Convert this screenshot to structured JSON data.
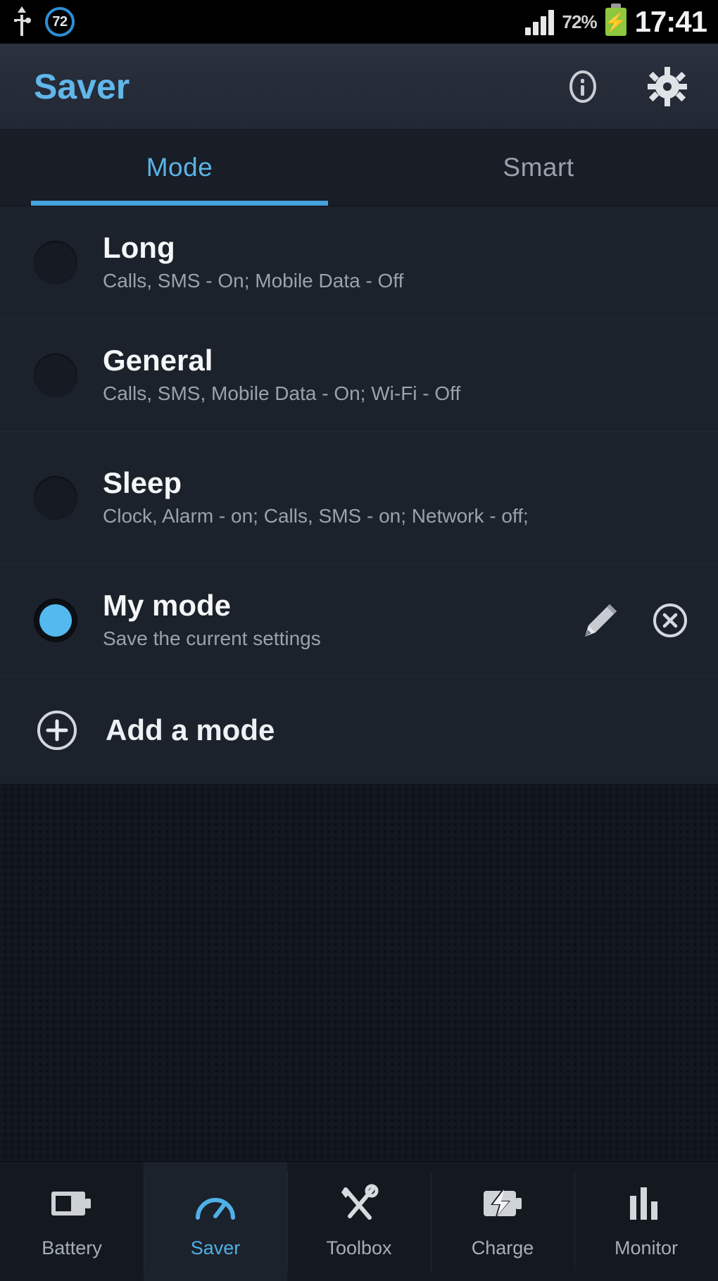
{
  "status_bar": {
    "usb_icon": "usb-icon",
    "sync_badge_value": "72",
    "signal_icon": "signal-bars-icon",
    "battery_percent": "72%",
    "battery_icon": "battery-charging-icon",
    "time": "17:41"
  },
  "action_bar": {
    "title": "Saver",
    "info_icon": "info-circle-icon",
    "settings_icon": "gear-icon"
  },
  "tabs": [
    {
      "label": "Mode",
      "active": true
    },
    {
      "label": "Smart",
      "active": false
    }
  ],
  "modes": [
    {
      "title": "Long",
      "subtitle": "Calls, SMS - On; Mobile Data - Off",
      "selected": false,
      "editable": false
    },
    {
      "title": "General",
      "subtitle": "Calls, SMS, Mobile Data - On; Wi-Fi - Off",
      "selected": false,
      "editable": false
    },
    {
      "title": "Sleep",
      "subtitle": "Clock, Alarm - on; Calls, SMS - on; Network - off;",
      "selected": false,
      "editable": false
    },
    {
      "title": "My mode",
      "subtitle": "Save the current settings",
      "selected": true,
      "editable": true,
      "edit_icon": "pencil-icon",
      "delete_icon": "close-circle-icon"
    }
  ],
  "add_mode": {
    "label": "Add a mode",
    "icon": "plus-circle-icon"
  },
  "bottom_nav": [
    {
      "label": "Battery",
      "icon": "battery-icon",
      "active": false
    },
    {
      "label": "Saver",
      "icon": "gauge-icon",
      "active": true
    },
    {
      "label": "Toolbox",
      "icon": "tools-icon",
      "active": false
    },
    {
      "label": "Charge",
      "icon": "charge-bolt-icon",
      "active": false
    },
    {
      "label": "Monitor",
      "icon": "bar-chart-icon",
      "active": false
    }
  ],
  "colors": {
    "accent": "#54b9ef",
    "title_accent": "#61b6ea",
    "battery_green": "#8ec63f",
    "list_bg": "#1c222c",
    "action_bar_bg": "#2b3240"
  }
}
